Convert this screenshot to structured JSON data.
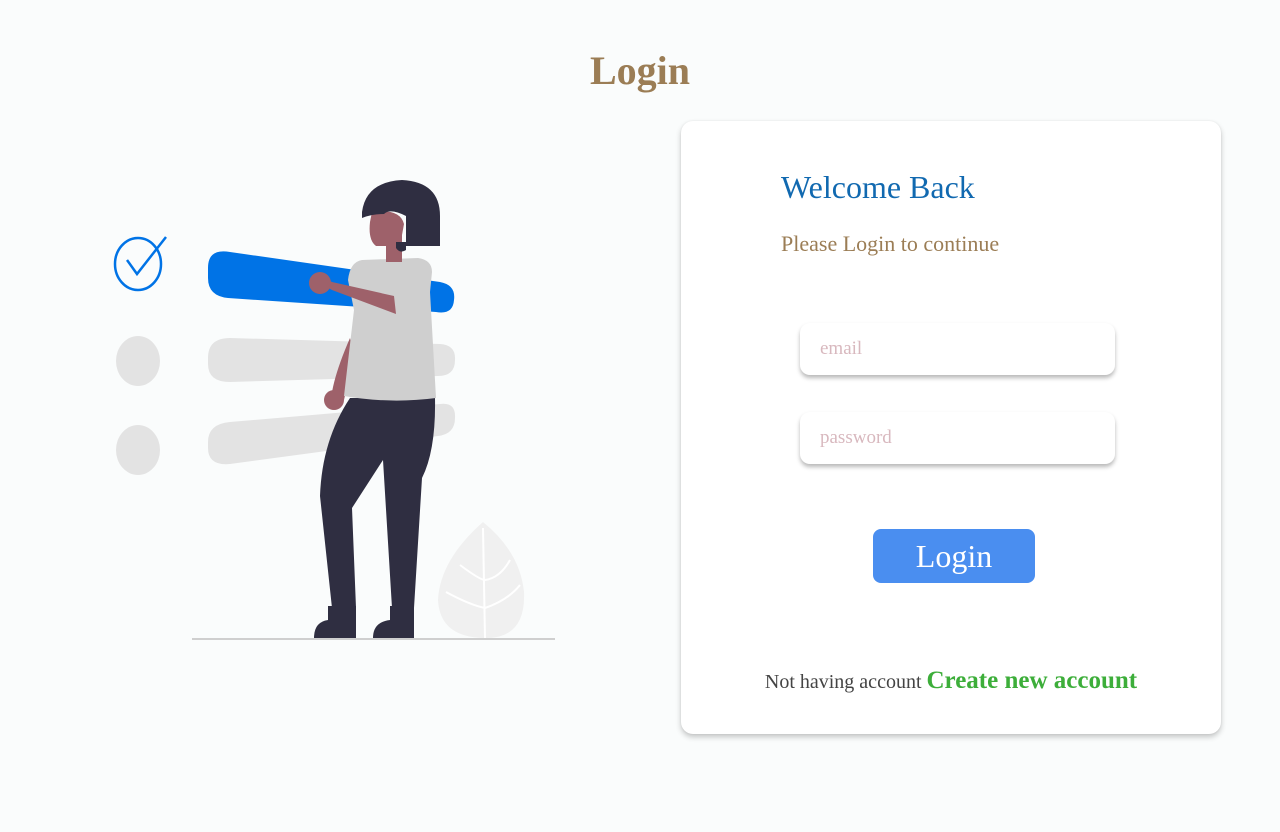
{
  "page": {
    "title": "Login"
  },
  "card": {
    "heading": "Welcome Back",
    "subtitle": "Please Login to continue",
    "email": {
      "placeholder": "email",
      "value": ""
    },
    "password": {
      "placeholder": "password",
      "value": ""
    },
    "login_label": "Login",
    "signup_prompt": "Not having account",
    "signup_link": "Create new account"
  },
  "colors": {
    "title": "#9b7d55",
    "heading": "#1169b0",
    "button": "#4a8ef0",
    "link": "#3dae3a",
    "accent": "#0073e6"
  },
  "illustration": {
    "icons": [
      "check-circle-icon",
      "person-icon",
      "leaf-icon"
    ]
  }
}
